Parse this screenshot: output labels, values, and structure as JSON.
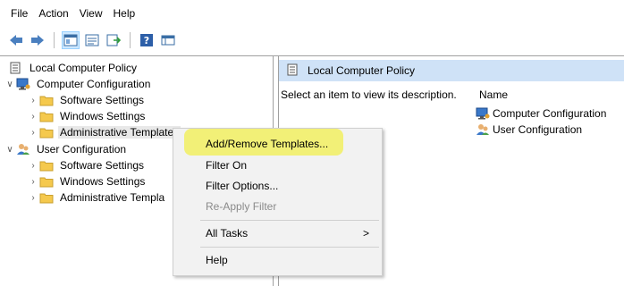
{
  "menubar": {
    "items": [
      "File",
      "Action",
      "View",
      "Help"
    ]
  },
  "toolbar": {
    "icons": [
      "back-icon",
      "forward-icon",
      "show-tree-icon",
      "properties-icon",
      "export-icon",
      "help-icon",
      "details-view-icon"
    ]
  },
  "tree": {
    "root": "Local Computer Policy",
    "computer": "Computer Configuration",
    "computer_children": [
      "Software Settings",
      "Windows Settings",
      "Administrative Templates"
    ],
    "user": "User Configuration",
    "user_children": [
      "Software Settings",
      "Windows Settings",
      "Administrative Templa"
    ]
  },
  "right_pane": {
    "header": "Local Computer Policy",
    "description": "Select an item to view its description.",
    "column_name": "Name",
    "items": [
      "Computer Configuration",
      "User Configuration"
    ]
  },
  "context_menu": {
    "items": [
      "Add/Remove Templates...",
      "Filter On",
      "Filter Options...",
      "Re-Apply Filter",
      "All Tasks",
      "Help"
    ],
    "submenu_arrow": ">"
  },
  "colors": {
    "highlight": "#fffd66",
    "header_bg": "#cfe2f7",
    "folder": "#f5c94d"
  }
}
